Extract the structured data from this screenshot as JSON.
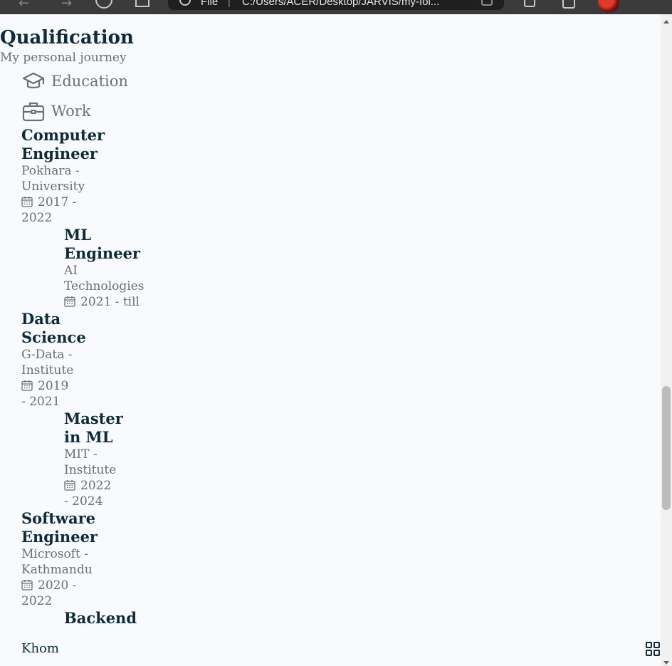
{
  "browser": {
    "address": {
      "scheme": "File",
      "url": "C:/Users/ACER/Desktop/JARVIS/my-fol..."
    }
  },
  "icons": {
    "education_tab": "graduation-cap-icon",
    "work_tab": "briefcase-icon",
    "date": "calendar-icon",
    "menu": "grid-icon"
  },
  "qualification": {
    "title": "Qualification",
    "subtitle": "My personal journey",
    "tabs": {
      "education": "Education",
      "work": "Work"
    },
    "timeline": [
      {
        "title_lines": [
          "Computer",
          "Engineer"
        ],
        "subtitle_lines": [
          "Pokhara -",
          "University"
        ],
        "date_lines": [
          "2017 -",
          "2022"
        ]
      },
      {
        "title_lines": [
          "ML",
          "Engineer"
        ],
        "subtitle_lines": [
          "AI",
          "Technologies"
        ],
        "date_lines": [
          "2021 - till"
        ]
      },
      {
        "title_lines": [
          "Data",
          "Science"
        ],
        "subtitle_lines": [
          "G-Data -",
          "Institute"
        ],
        "date_lines": [
          "2019",
          "- 2021"
        ]
      },
      {
        "title_lines": [
          "Master",
          "in ML"
        ],
        "subtitle_lines": [
          "MIT -",
          "Institute"
        ],
        "date_lines": [
          "2022",
          "- 2024"
        ]
      },
      {
        "title_lines": [
          "Software",
          "Engineer"
        ],
        "subtitle_lines": [
          "Microsoft -",
          "Kathmandu"
        ],
        "date_lines": [
          "2020 -",
          "2022"
        ]
      },
      {
        "title_lines": [
          "Backend"
        ]
      }
    ]
  },
  "footer": {
    "brand": "Khom"
  },
  "colors": {
    "heading": "#0f2b3a",
    "muted": "#6a6f73",
    "background": "#f8fafd"
  }
}
